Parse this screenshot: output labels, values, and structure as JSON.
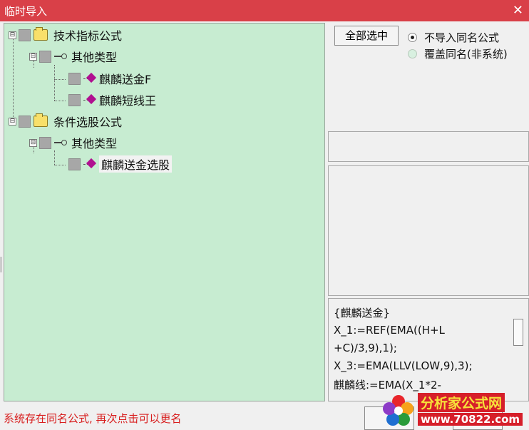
{
  "window": {
    "title": "临时导入",
    "close_icon": "close-icon"
  },
  "tree": {
    "groups": [
      {
        "label": "技术指标公式",
        "icon": "folder-icon",
        "category": {
          "label": "其他类型",
          "icon": "key-icon",
          "items": [
            {
              "label": "麒麟送金F",
              "icon": "formula-icon"
            },
            {
              "label": "麒麟短线王",
              "icon": "formula-icon"
            }
          ]
        }
      },
      {
        "label": "条件选股公式",
        "icon": "folder-icon",
        "category": {
          "label": "其他类型",
          "icon": "key-icon",
          "items": [
            {
              "label": "麒麟送金选股",
              "icon": "formula-icon",
              "selected": true
            }
          ]
        }
      }
    ],
    "expander_symbol": "⊟"
  },
  "options": {
    "select_all_label": "全部选中",
    "radio_no_import_label": "不导入同名公式",
    "radio_overwrite_label": "覆盖同名(非系统)",
    "selected": "no_import"
  },
  "code": {
    "lines": [
      "{麒麟送金}",
      "X_1:=REF(EMA((H+L",
      "+C)/3,9),1);",
      "X_3:=EMA(LLV(LOW,9),3);",
      "麒麟线:=EMA(X_1*2-"
    ]
  },
  "status_text": "系统存在同名公式, 再次点击可以更名",
  "watermark": {
    "line1": "分析家公式网",
    "line2": "www.70822.com",
    "colors": {
      "bg": "#d61f2a",
      "text1": "#f7e23a"
    }
  },
  "colors": {
    "titlebar": "#d94048",
    "tree_bg": "#c7ecd1",
    "status": "#d81e1e"
  }
}
